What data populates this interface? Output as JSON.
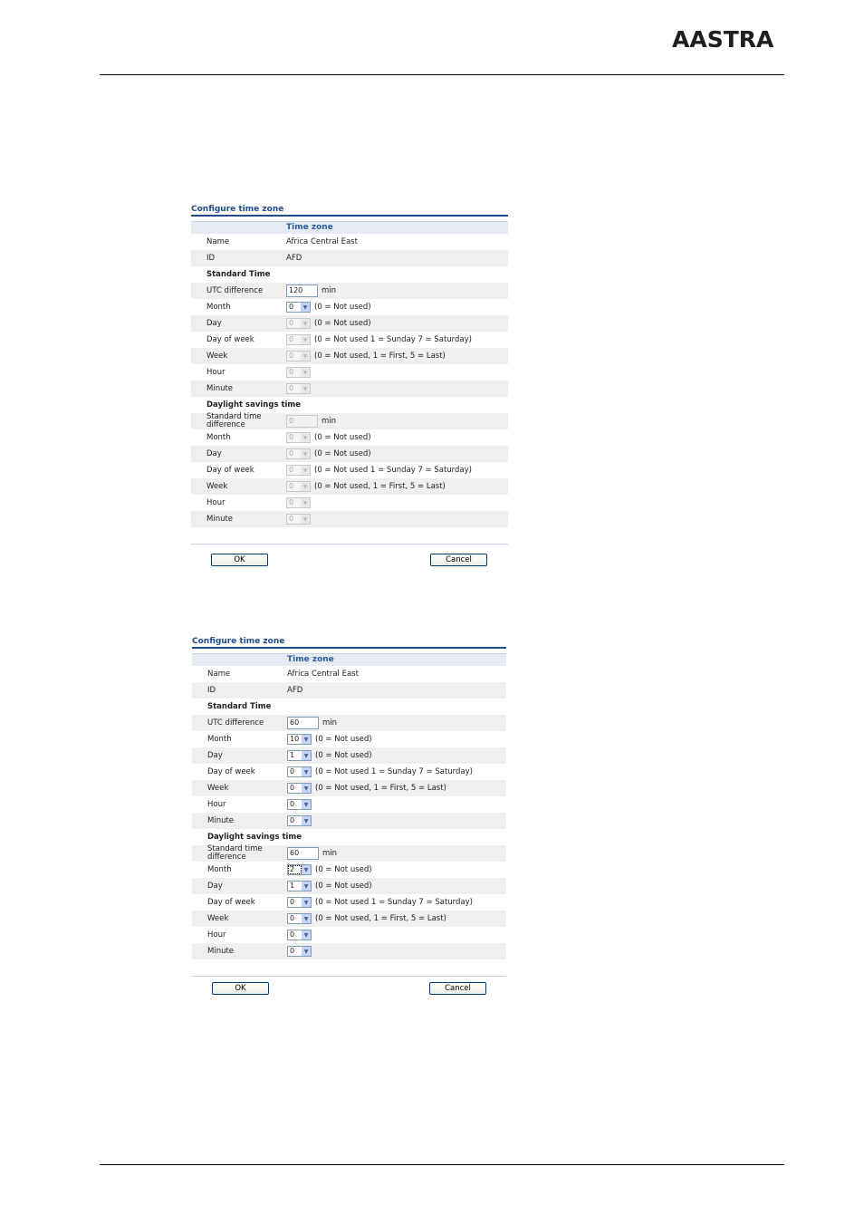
{
  "brand": "AASTRA",
  "panels": [
    {
      "title": "Configure time zone",
      "section": "Time zone",
      "name_label": "Name",
      "name_value": "Africa Central East",
      "id_label": "ID",
      "id_value": "AFD",
      "standard_heading": "Standard Time",
      "utc_label": "UTC difference",
      "utc_value": "120",
      "min_unit": "min",
      "month_label": "Month",
      "month_value": "0",
      "month_note": "(0 = Not used)",
      "day_label": "Day",
      "day_value": "0",
      "day_note": "(0 = Not used)",
      "dow_label": "Day of week",
      "dow_value": "0",
      "dow_note": "(0 = Not used 1 = Sunday 7 = Saturday)",
      "week_label": "Week",
      "week_value": "0",
      "week_note": "(0 = Not used, 1 = First, 5 = Last)",
      "hour_label": "Hour",
      "hour_value": "0",
      "minute_label": "Minute",
      "minute_value": "0",
      "dst_heading": "Daylight savings time",
      "std_diff_label": "Standard time difference",
      "std_diff_value": "0",
      "dst_month_value": "0",
      "dst_day_value": "0",
      "dst_dow_value": "0",
      "dst_week_value": "0",
      "dst_hour_value": "0",
      "dst_minute_value": "0",
      "ok_label": "OK",
      "cancel_label": "Cancel"
    },
    {
      "title": "Configure time zone",
      "section": "Time zone",
      "name_label": "Name",
      "name_value": "Africa Central East",
      "id_label": "ID",
      "id_value": "AFD",
      "standard_heading": "Standard Time",
      "utc_label": "UTC difference",
      "utc_value": "60",
      "min_unit": "min",
      "month_label": "Month",
      "month_value": "10",
      "month_note": "(0 = Not used)",
      "day_label": "Day",
      "day_value": "1",
      "day_note": "(0 = Not used)",
      "dow_label": "Day of week",
      "dow_value": "0",
      "dow_note": "(0 = Not used 1 = Sunday 7 = Saturday)",
      "week_label": "Week",
      "week_value": "0",
      "week_note": "(0 = Not used, 1 = First, 5 = Last)",
      "hour_label": "Hour",
      "hour_value": "0",
      "minute_label": "Minute",
      "minute_value": "0",
      "dst_heading": "Daylight savings time",
      "std_diff_label": "Standard time difference",
      "std_diff_value": "60",
      "dst_month_value": "2",
      "dst_day_value": "1",
      "dst_dow_value": "0",
      "dst_week_value": "0",
      "dst_hour_value": "0",
      "dst_minute_value": "0",
      "ok_label": "OK",
      "cancel_label": "Cancel"
    }
  ]
}
